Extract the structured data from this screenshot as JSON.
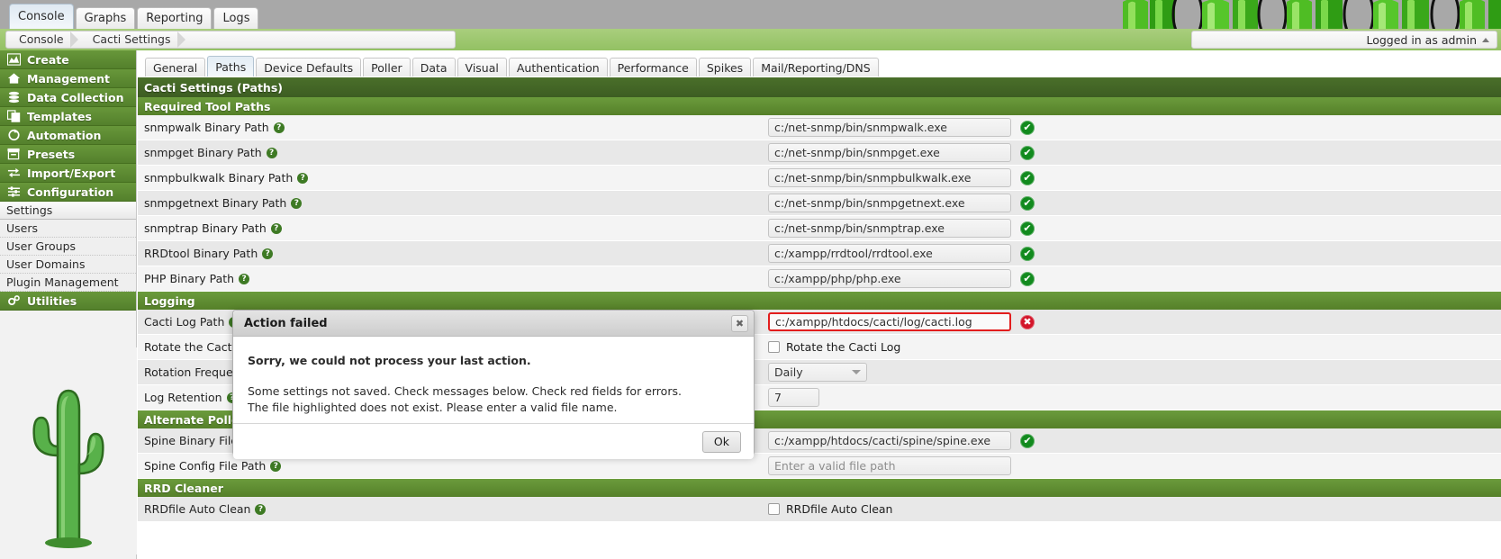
{
  "topbar": {
    "tabs": [
      {
        "label": "Console",
        "active": true
      },
      {
        "label": "Graphs",
        "active": false
      },
      {
        "label": "Reporting",
        "active": false
      },
      {
        "label": "Logs",
        "active": false
      }
    ]
  },
  "breadcrumb": {
    "items": [
      "Console",
      "Cacti Settings"
    ],
    "login_text": "Logged in as admin"
  },
  "sidebar": {
    "groups": [
      {
        "label": "Create",
        "icon": "chart-icon"
      },
      {
        "label": "Management",
        "icon": "home-icon"
      },
      {
        "label": "Data Collection",
        "icon": "database-icon"
      },
      {
        "label": "Templates",
        "icon": "copy-icon"
      },
      {
        "label": "Automation",
        "icon": "refresh-icon"
      },
      {
        "label": "Presets",
        "icon": "archive-icon"
      },
      {
        "label": "Import/Export",
        "icon": "exchange-icon"
      },
      {
        "label": "Configuration",
        "icon": "sliders-icon"
      }
    ],
    "config_items": [
      {
        "label": "Settings",
        "selected": true
      },
      {
        "label": "Users",
        "selected": false
      },
      {
        "label": "User Groups",
        "selected": false
      },
      {
        "label": "User Domains",
        "selected": false
      },
      {
        "label": "Plugin Management",
        "selected": false
      }
    ],
    "utilities": {
      "label": "Utilities",
      "icon": "gears-icon"
    }
  },
  "main": {
    "tabs": [
      {
        "label": "General",
        "active": false
      },
      {
        "label": "Paths",
        "active": true
      },
      {
        "label": "Device Defaults",
        "active": false
      },
      {
        "label": "Poller",
        "active": false
      },
      {
        "label": "Data",
        "active": false
      },
      {
        "label": "Visual",
        "active": false
      },
      {
        "label": "Authentication",
        "active": false
      },
      {
        "label": "Performance",
        "active": false
      },
      {
        "label": "Spikes",
        "active": false
      },
      {
        "label": "Mail/Reporting/DNS",
        "active": false
      }
    ],
    "page_title": "Cacti Settings (Paths)",
    "sections": [
      {
        "name": "Required Tool Paths",
        "rows": [
          {
            "label": "snmpwalk Binary Path",
            "help": true,
            "type": "text",
            "value": "c:/net-snmp/bin/snmpwalk.exe",
            "status": "ok"
          },
          {
            "label": "snmpget Binary Path",
            "help": true,
            "type": "text",
            "value": "c:/net-snmp/bin/snmpget.exe",
            "status": "ok"
          },
          {
            "label": "snmpbulkwalk Binary Path",
            "help": true,
            "type": "text",
            "value": "c:/net-snmp/bin/snmpbulkwalk.exe",
            "status": "ok"
          },
          {
            "label": "snmpgetnext Binary Path",
            "help": true,
            "type": "text",
            "value": "c:/net-snmp/bin/snmpgetnext.exe",
            "status": "ok"
          },
          {
            "label": "snmptrap Binary Path",
            "help": true,
            "type": "text",
            "value": "c:/net-snmp/bin/snmptrap.exe",
            "status": "ok"
          },
          {
            "label": "RRDtool Binary Path",
            "help": true,
            "type": "text",
            "value": "c:/xampp/rrdtool/rrdtool.exe",
            "status": "ok"
          },
          {
            "label": "PHP Binary Path",
            "help": true,
            "type": "text",
            "value": "c:/xampp/php/php.exe",
            "status": "ok"
          }
        ]
      },
      {
        "name": "Logging",
        "rows": [
          {
            "label": "Cacti Log Path",
            "help": true,
            "type": "text",
            "value": "c:/xampp/htdocs/cacti/log/cacti.log",
            "status": "error",
            "error": true
          },
          {
            "label": "Rotate the Cacti Log",
            "help": false,
            "type": "checkbox",
            "cb_label": "Rotate the Cacti Log",
            "checked": false
          },
          {
            "label": "Rotation Frequency",
            "help": false,
            "type": "select",
            "value": "Daily"
          },
          {
            "label": "Log Retention",
            "help": true,
            "type": "number",
            "value": "7"
          }
        ]
      },
      {
        "name": "Alternate Poller",
        "rows": [
          {
            "label": "Spine Binary File Path",
            "help": false,
            "type": "text",
            "value": "c:/xampp/htdocs/cacti/spine/spine.exe",
            "status": "ok"
          },
          {
            "label": "Spine Config File Path",
            "help": true,
            "type": "text",
            "value": "",
            "placeholder": "Enter a valid file path"
          }
        ]
      },
      {
        "name": "RRD Cleaner",
        "rows": [
          {
            "label": "RRDfile Auto Clean",
            "help": true,
            "type": "checkbox",
            "cb_label": "RRDfile Auto Clean",
            "checked": false
          }
        ]
      }
    ]
  },
  "modal": {
    "title": "Action failed",
    "close_label": "✖",
    "lead": "Sorry, we could not process your last action.",
    "line1": "Some settings not saved. Check messages below. Check red fields for errors.",
    "line2": "The file highlighted does not exist. Please enter a valid file name.",
    "ok_label": "Ok"
  },
  "colors": {
    "brand_green": "#6b9b3c",
    "dark_green": "#4a6f2a",
    "header_green": "#93c163",
    "error_red": "#e21d1d",
    "ok_green": "#128a1e"
  }
}
